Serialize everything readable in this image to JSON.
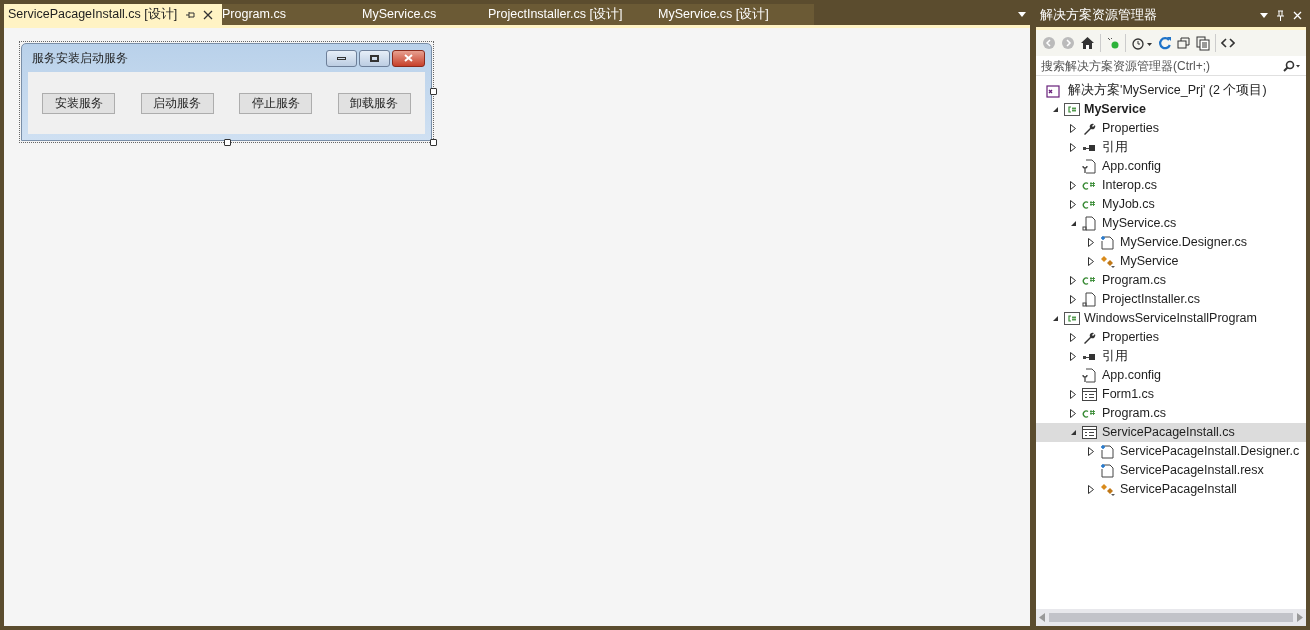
{
  "tabs": [
    {
      "label": "ServicePacageInstall.cs [设计]",
      "selected": true
    },
    {
      "label": "Program.cs",
      "selected": false
    },
    {
      "label": "MyService.cs",
      "selected": false
    },
    {
      "label": "ProjectInstaller.cs [设计]",
      "selected": false
    },
    {
      "label": "MyService.cs [设计]",
      "selected": false
    }
  ],
  "form": {
    "title": "服务安装启动服务",
    "buttons": [
      "安装服务",
      "启动服务",
      "停止服务",
      "卸载服务"
    ]
  },
  "solution_explorer": {
    "title": "解决方案资源管理器",
    "search": {
      "placeholder": "搜索解决方案资源管理器(Ctrl+;)"
    },
    "tree": {
      "label": "解决方案'MyService_Prj' (2 个项目)",
      "kind": "solution",
      "children": [
        {
          "label": "MyService",
          "kind": "project",
          "startup": true,
          "expanded": true,
          "selected": false,
          "children": [
            {
              "label": "Properties",
              "kind": "properties",
              "expanded": false,
              "selected": false
            },
            {
              "label": "引用",
              "kind": "references",
              "expanded": false,
              "selected": false
            },
            {
              "label": "App.config",
              "kind": "config",
              "selected": false
            },
            {
              "label": "Interop.cs",
              "kind": "csharp",
              "expanded": false,
              "selected": false
            },
            {
              "label": "MyJob.cs",
              "kind": "csharp",
              "expanded": false,
              "selected": false
            },
            {
              "label": "MyService.cs",
              "kind": "component",
              "expanded": true,
              "selected": false,
              "children": [
                {
                  "label": "MyService.Designer.cs",
                  "kind": "designer",
                  "expanded": false,
                  "selected": false
                },
                {
                  "label": "MyService",
                  "kind": "class",
                  "expanded": false,
                  "selected": false
                }
              ]
            },
            {
              "label": "Program.cs",
              "kind": "csharp",
              "expanded": false,
              "selected": false
            },
            {
              "label": "ProjectInstaller.cs",
              "kind": "component",
              "expanded": false,
              "selected": false
            }
          ]
        },
        {
          "label": "WindowsServiceInstallProgram",
          "kind": "project",
          "startup": false,
          "expanded": true,
          "selected": false,
          "children": [
            {
              "label": "Properties",
              "kind": "properties",
              "expanded": false,
              "selected": false
            },
            {
              "label": "引用",
              "kind": "references",
              "expanded": false,
              "selected": false
            },
            {
              "label": "App.config",
              "kind": "config",
              "selected": false
            },
            {
              "label": "Form1.cs",
              "kind": "form",
              "expanded": false,
              "selected": false
            },
            {
              "label": "Program.cs",
              "kind": "csharp",
              "expanded": false,
              "selected": false
            },
            {
              "label": "ServicePacageInstall.cs",
              "kind": "form",
              "expanded": true,
              "selected": true,
              "children": [
                {
                  "label": "ServicePacageInstall.Designer.c",
                  "kind": "designer",
                  "expanded": false,
                  "selected": false
                },
                {
                  "label": "ServicePacageInstall.resx",
                  "kind": "designer",
                  "selected": false
                },
                {
                  "label": "ServicePacageInstall",
                  "kind": "class",
                  "expanded": false,
                  "selected": false
                }
              ]
            }
          ]
        }
      ]
    }
  }
}
